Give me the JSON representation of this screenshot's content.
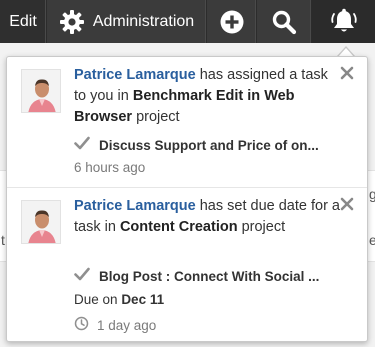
{
  "navbar": {
    "edit_label": "Edit",
    "admin_label": "Administration",
    "icons": [
      "gear-icon",
      "plus-circle-icon",
      "search-icon",
      "bell-icon"
    ]
  },
  "background": {
    "edge_glyph_left": "t",
    "edge_glyph_right": "g",
    "edge_glyph_right2": "e"
  },
  "notifications": [
    {
      "actor": "Patrice Lamarque",
      "text_before": "has assigned a task to you in",
      "object": "Benchmark Edit in Web Browser",
      "text_after": "project",
      "task": "Discuss Support and Price of on...",
      "time": "6 hours ago"
    },
    {
      "actor": "Patrice Lamarque",
      "text_before": "has set due date for a task in",
      "object": "Content Creation",
      "text_after": "project",
      "task": "Blog Post : Connect With Social ...",
      "due_prefix": "Due on",
      "due_date": "Dec 11",
      "time": "1 day ago"
    }
  ],
  "colors": {
    "navbar": "#3b3b3b",
    "link": "#2a5f9e",
    "muted": "#7a7a7a"
  }
}
